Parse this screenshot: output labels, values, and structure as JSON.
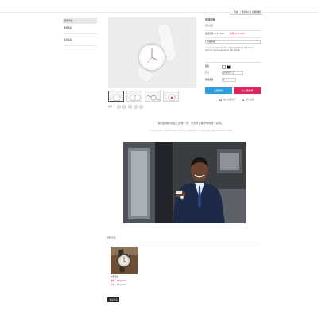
{
  "top_nav": {
    "items": [
      "登錄",
      "會員中心",
      "結帳購物"
    ]
  },
  "sidebar": {
    "header": "選單列表",
    "items": [
      "推薦商品",
      "最新商品"
    ]
  },
  "product": {
    "title": "經典腕錶",
    "subtitle": "簡約風格",
    "price_line_prefix": "建議售價 NT$3,990",
    "price_line_sale": "優惠 NT$2,999",
    "description": "Lorem ipsum has been the industry's standard dummy text ever since the 1500s",
    "select_label": "規格選擇",
    "color_label": "顏色",
    "size_label": "尺寸",
    "size_value": "請選擇尺寸",
    "qty_label": "購買數量",
    "qty_value": "1",
    "buy_now": "立即購買",
    "add_cart": "加入購物車",
    "option_a": "加入追蹤清單",
    "option_b": "加入比較",
    "share_label": "分享"
  },
  "promo": {
    "headline": "優質腕錶的精品工藝與一流，完全符合都會時尚男士品味。",
    "subline": "Lorem ipsum has been the industry's standard dummy text ever since the 1500s"
  },
  "related": {
    "section_title": "相關商品",
    "card": {
      "name": "經典腕錶",
      "price_sale": "優惠：NT$2999",
      "price_orig": "原價：NT$3990"
    },
    "more_button": "更多商品"
  },
  "colors": {
    "buy_now_bg": "#2f9ee0",
    "add_cart_bg": "#e0245e",
    "sale_text": "#e0245e",
    "dark_button": "#222222"
  }
}
